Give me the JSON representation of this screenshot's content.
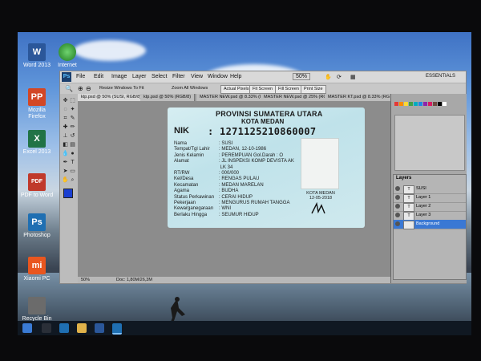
{
  "desktop": {
    "icons": [
      {
        "label": "Word 2013",
        "glyph": "W",
        "color": "#2b579a"
      },
      {
        "label": "Mozilla Firefox",
        "glyph": "PP",
        "color": "#d24726"
      },
      {
        "label": "Excel 2013",
        "glyph": "X",
        "color": "#217346"
      },
      {
        "label": "PDF to Word",
        "glyph": "PDF",
        "color": "#c0392b"
      },
      {
        "label": "Photoshop",
        "glyph": "Ps",
        "color": "#1f6fb2"
      },
      {
        "label": "Xiaomi PC",
        "glyph": "mi",
        "color": "#e9561f"
      },
      {
        "label": "Recycle Bin",
        "glyph": "",
        "color": "#6b6b6b"
      }
    ],
    "idm_label": "Internet"
  },
  "photoshop": {
    "logo": "Ps",
    "menu": [
      "File",
      "Edit",
      "Image",
      "Layer",
      "Select",
      "Filter",
      "View",
      "Window",
      "Help"
    ],
    "zoom_readout": "50%",
    "workspace": "ESSENTIALS",
    "options": {
      "resize_windows": "Resize Windows To Fit",
      "zoom_all": "Zoom All Windows",
      "actual_pixels": "Actual Pixels",
      "fit_screen": "Fit Screen",
      "fill_screen": "Fill Screen",
      "print_size": "Print Size"
    },
    "tabs": [
      "ktp.psd @ 50% (SUSI, RGB/8)",
      "ktp.psd @ 50% (RGB/8)",
      "MASTER NEW.psd @ 8.33% (R",
      "MASTER NEW.psd @ 25% (RGB",
      "MASTER KT.psd @ 8.33% (RG"
    ],
    "status": {
      "zoom": "50%",
      "doc": "Doc: 1,80M/26,3M"
    },
    "layers": [
      "SUSI",
      "Layer 1",
      "Layer 2",
      "Layer 3",
      "Background"
    ],
    "layers_title": "Layers"
  },
  "idcard": {
    "province": "PROVINSI SUMATERA UTARA",
    "city": "KOTA MEDAN",
    "nik_label": "NIK",
    "nik": ": 1271125210860007",
    "fields": [
      {
        "k": "Nama",
        "v": ": SUSI"
      },
      {
        "k": "Tempat/Tgl Lahir",
        "v": ": MEDAN, 12-10-1986"
      },
      {
        "k": "Jenis Kelamin",
        "v": ": PEREMPUAN     Gol.Darah : O"
      },
      {
        "k": "Alamat",
        "v": ": JL INSPEKSI KOMP DEVISTA AK"
      },
      {
        "k": "",
        "v": "  LK 34"
      },
      {
        "k": "RT/RW",
        "v": ": 000/000"
      },
      {
        "k": "Kel/Desa",
        "v": ": RENGAS PULAU"
      },
      {
        "k": "Kecamatan",
        "v": ": MEDAN MARELAN"
      },
      {
        "k": "Agama",
        "v": ": BUDHA"
      },
      {
        "k": "Status Perkawinan",
        "v": ": CERAI HIDUP"
      },
      {
        "k": "Pekerjaan",
        "v": ": MENGURUS RUMAH TANGGA"
      },
      {
        "k": "Kewarganegaraan",
        "v": ": WNI"
      },
      {
        "k": "Berlaku Hingga",
        "v": ": SEUMUR HIDUP"
      }
    ],
    "sign_city": "KOTA MEDAN",
    "sign_date": "12-05-2018"
  }
}
